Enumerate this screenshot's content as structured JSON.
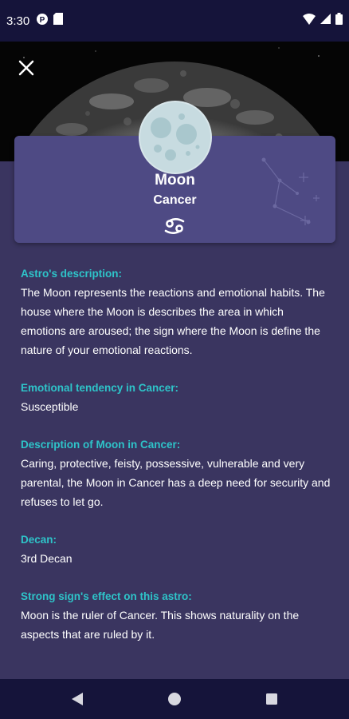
{
  "status_bar": {
    "time": "3:30"
  },
  "header": {
    "title": "Moon",
    "subtitle": "Cancer",
    "sign_icon": "cancer-zodiac-icon"
  },
  "sections": [
    {
      "heading": "Astro's description:",
      "body": "The Moon represents the reactions and emotional habits. The house where the Moon is describes the area in which emotions are aroused; the sign where the Moon is define the nature of your emotional reactions."
    },
    {
      "heading": "Emotional tendency in Cancer:",
      "body": "Susceptible"
    },
    {
      "heading": "Description of Moon in Cancer:",
      "body": "Caring, protective, feisty, possessive, vulnerable and very parental, the Moon in Cancer has a deep need for security and refuses to let go."
    },
    {
      "heading": "Decan:",
      "body": "3rd Decan"
    },
    {
      "heading": "Strong sign's effect on this astro:",
      "body": "Moon is the ruler of Cancer. This shows naturality on the aspects that are ruled by it."
    }
  ],
  "colors": {
    "background": "#3a3560",
    "card": "#4e4a84",
    "heading_accent": "#2ec4c9",
    "bars": "#15143a"
  }
}
